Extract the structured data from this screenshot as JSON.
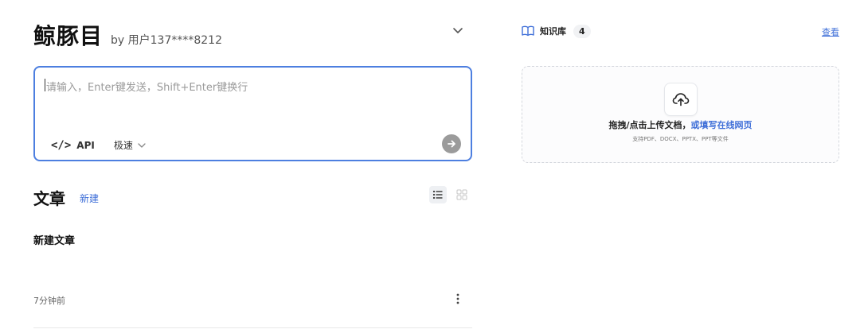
{
  "header": {
    "title": "鲸豚目",
    "byline": "by 用户137****8212"
  },
  "chat_input": {
    "placeholder": "请输入，Enter键发送，Shift+Enter键换行",
    "value": "",
    "api_label": "API",
    "api_icon_text": "</>",
    "speed_label": "极速"
  },
  "articles_section": {
    "title": "文章",
    "new_label": "新建",
    "items": [
      {
        "title": "新建文章",
        "time": "7分钟前"
      }
    ]
  },
  "knowledge_base": {
    "label": "知识库",
    "count": "4",
    "view_label": "查看",
    "upload_text": "拖拽/点击上传文档，",
    "upload_link": "或填写在线网页",
    "upload_hint": "支持PDF、DOCX、PPTX、PPT等文件"
  },
  "colors": {
    "accent": "#3f6fd8",
    "input_border": "#4d7fe0",
    "send_button": "#9b9b9b"
  },
  "icons": [
    "chevron-down-icon",
    "api-code-icon",
    "arrow-right-icon",
    "list-view-icon",
    "grid-view-icon",
    "more-vertical-icon",
    "book-icon",
    "upload-cloud-icon"
  ]
}
